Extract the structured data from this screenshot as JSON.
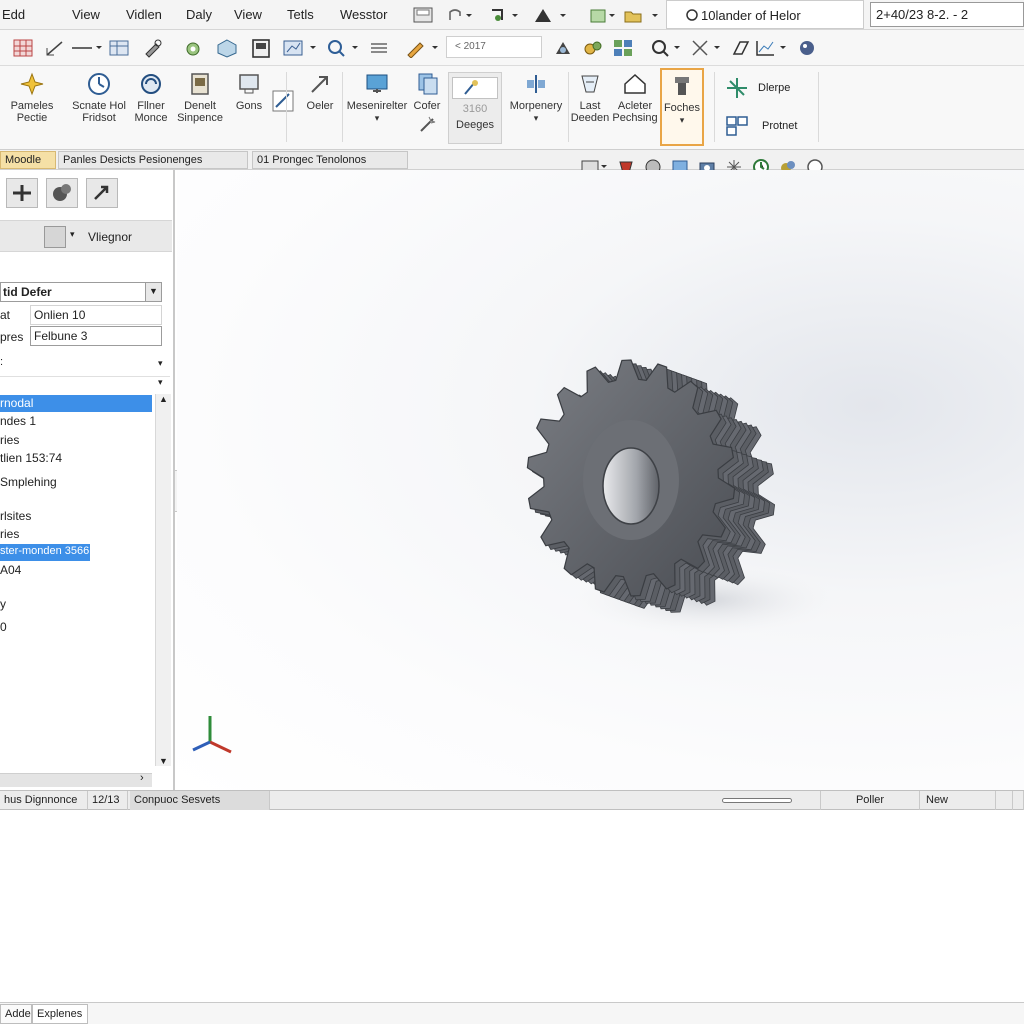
{
  "menubar": {
    "items": [
      "Edd",
      "View",
      "Vidlen",
      "Daly",
      "View",
      "Tetls",
      "Wesstor"
    ],
    "title": "10lander of Helor",
    "coords": "2+40/23 8-2. - 2"
  },
  "toolbar2": {
    "field_value": "< 2017"
  },
  "ribbon": {
    "buttons": [
      {
        "line1": "Pameles",
        "line2": "Pectie"
      },
      {
        "line1": "Scnate Hol",
        "line2": "Fridsot"
      },
      {
        "line1": "Fllner",
        "line2": "Monce"
      },
      {
        "line1": "Denelt",
        "line2": "Sinpence"
      },
      {
        "line1": "Gons",
        "line2": ""
      },
      {
        "line1": "Oeler",
        "line2": ""
      },
      {
        "line1": "Mesenirelter",
        "line2": ""
      },
      {
        "line1": "Cofer",
        "line2": ""
      },
      {
        "line1": "3160",
        "line2": "Deeges"
      },
      {
        "line1": "Morpenery",
        "line2": ""
      },
      {
        "line1": "Last",
        "line2": "Deeden"
      },
      {
        "line1": "Acleter",
        "line2": "Pechsing"
      },
      {
        "line1": "Foches",
        "line2": ""
      },
      {
        "line1": "Dlerpe",
        "line2": ""
      },
      {
        "line1": "Protnet",
        "line2": ""
      }
    ]
  },
  "tabs": {
    "model": "Moodle",
    "tab2": "Panles Desicts Pesionenges",
    "tab3": "01 Prongec Tenolonos"
  },
  "leftpane": {
    "pm_label": "Vliegnor",
    "param_select": "tid Defer",
    "field1_label": "at",
    "field1_value": "Onlien 10",
    "field2_label": "pres",
    "field2_value": "Felbune 3",
    "tree": [
      "rnodal",
      "ndes 1",
      "ries",
      "tlien 153:74",
      "Smplehing",
      "rlsites",
      "ries",
      "ster-monden 3566",
      "A04",
      "y",
      "0"
    ]
  },
  "statusbar": {
    "cell1": "hus Dignnonce",
    "cell2": "12/13",
    "cell3": "Conpuoc Sesvets",
    "right1": "Poller",
    "right2": "New"
  },
  "bottom_tabs": [
    "Adde",
    "Explenes"
  ],
  "colors": {
    "accent": "#3d8fe8",
    "highlight": "#e9a546",
    "model_tab": "#f5e0a6"
  }
}
